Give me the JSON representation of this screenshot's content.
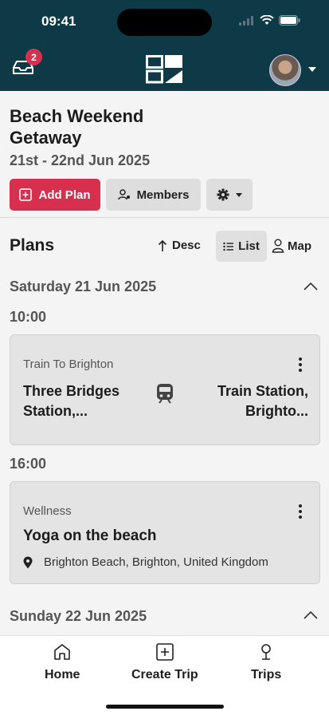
{
  "status": {
    "time": "09:41"
  },
  "header": {
    "inbox_badge": "2"
  },
  "trip": {
    "title": "Beach Weekend Getaway",
    "dates": "21st - 22nd Jun 2025"
  },
  "actions": {
    "add_plan": "Add Plan",
    "members": "Members"
  },
  "plans": {
    "title": "Plans",
    "sort_label": "Desc",
    "view_list": "List",
    "view_map": "Map"
  },
  "days": [
    {
      "label": "Saturday 21 Jun 2025"
    },
    {
      "label": "Sunday 22 Jun 2025"
    }
  ],
  "items": [
    {
      "time": "10:00",
      "category": "Train To Brighton",
      "from": "Three Bridges Station,...",
      "to": "Train Station, Brighto..."
    },
    {
      "time": "16:00",
      "category": "Wellness",
      "name": "Yoga on the beach",
      "location": "Brighton Beach, Brighton, United Kingdom"
    }
  ],
  "tabbar": {
    "home": "Home",
    "create": "Create Trip",
    "trips": "Trips"
  },
  "colors": {
    "header": "#0e3a47",
    "accent": "#d7304f"
  }
}
